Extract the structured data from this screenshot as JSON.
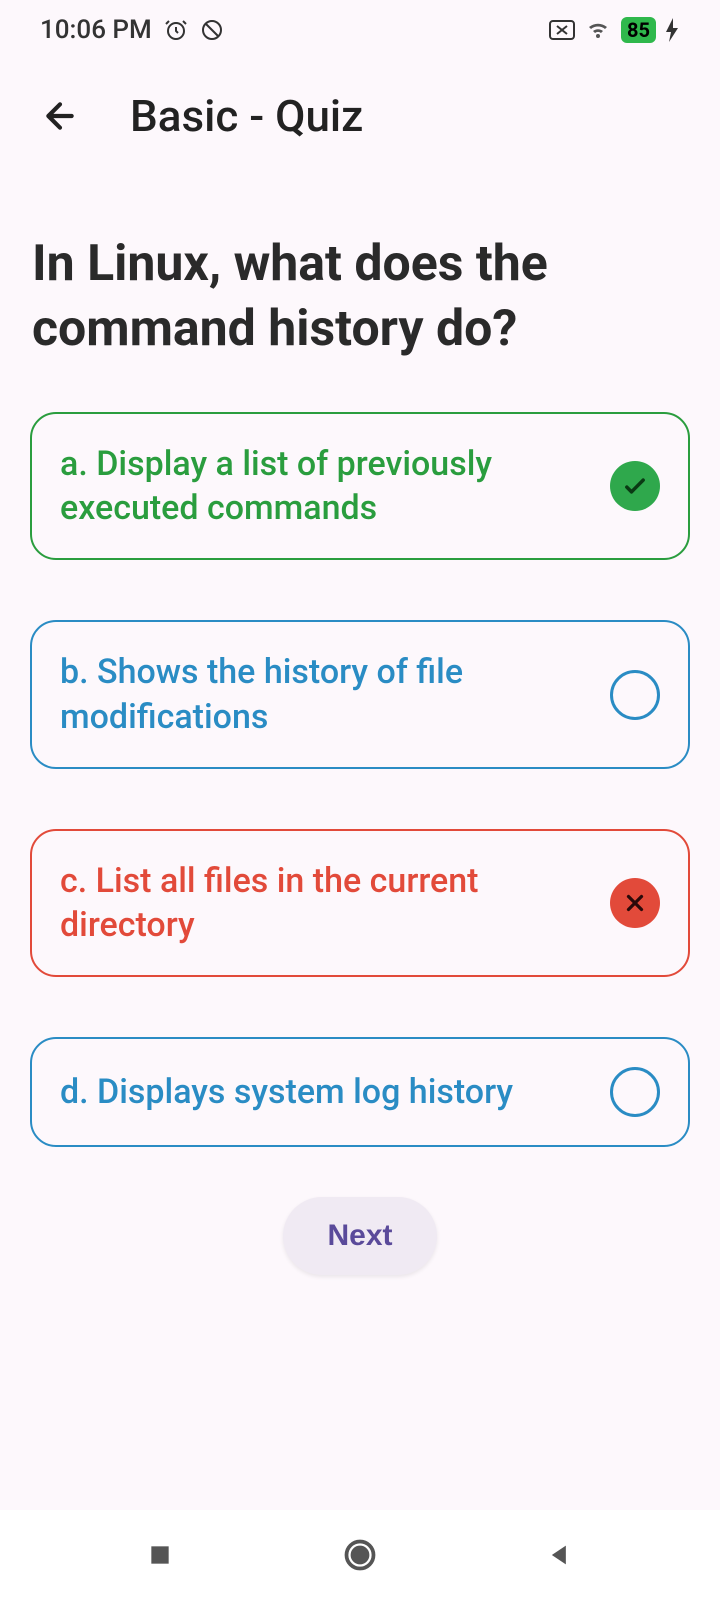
{
  "status_bar": {
    "time": "10:06 PM",
    "battery": "85"
  },
  "header": {
    "title": "Basic - Quiz"
  },
  "question": "In Linux, what does the command history do?",
  "options": [
    {
      "label": "a. Display a list of previously executed commands",
      "state": "correct"
    },
    {
      "label": "b. Shows the history of file modifications",
      "state": "neutral"
    },
    {
      "label": "c. List all files in the current directory",
      "state": "wrong"
    },
    {
      "label": "d. Displays system log history",
      "state": "neutral"
    }
  ],
  "next_label": "Next"
}
